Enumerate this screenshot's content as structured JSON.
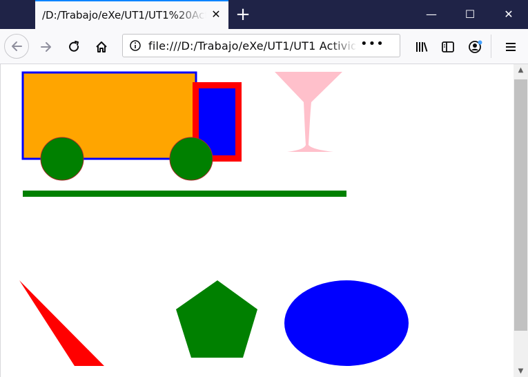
{
  "browser": {
    "tab_title": "/D:/Trabajo/eXe/UT1/UT1%20Actividad",
    "tab_close": "✕",
    "new_tab": "+",
    "url": "file:///D:/Trabajo/eXe/UT1/UT1 Actividad vo",
    "page_actions": "•••",
    "window_controls": {
      "minimize": "—",
      "maximize": "☐",
      "close": "✕"
    },
    "scroll": {
      "up": "▲",
      "down": "▼"
    }
  },
  "icons": {
    "back": "back-arrow-icon",
    "forward": "forward-arrow-icon",
    "reload": "reload-icon",
    "home": "home-icon",
    "info": "info-icon",
    "library": "library-icon",
    "sidebar": "sidebar-icon",
    "account": "account-icon",
    "menu": "hamburger-menu-icon"
  },
  "colors": {
    "titlebar": "#1f2347",
    "accent": "#0a84ff",
    "truck_body": "#ffa500",
    "truck_outline": "#0000ff",
    "cab_outline": "#ff0000",
    "cab_fill": "#0000ff",
    "wheels": "#008000",
    "wheel_outline": "#a52a2a",
    "road": "#008000",
    "glass": "#ffc0cb",
    "triangle": "#ff0000",
    "pentagon": "#008000",
    "ellipse": "#0000ff"
  }
}
